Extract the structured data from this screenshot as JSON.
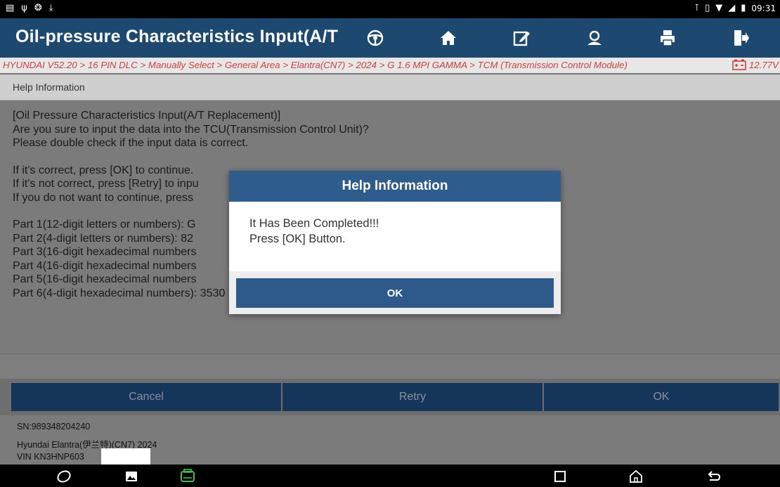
{
  "status_bar": {
    "left_icons": [
      "notification-icon",
      "usb-icon",
      "accessibility-icon",
      "download-icon"
    ],
    "right_icons": [
      "bluetooth-icon",
      "vibrate-icon",
      "wifi-icon",
      "signal-icon",
      "battery-icon"
    ],
    "time": "09:31"
  },
  "title_bar": {
    "title": "Oil-pressure Characteristics Input(A/T",
    "buttons": [
      "steering-wheel-icon",
      "home-icon",
      "edit-report-icon",
      "user-profile-icon",
      "printer-icon",
      "exit-icon"
    ]
  },
  "breadcrumb": {
    "path": "HYUNDAI V52.20 > 16 PIN DLC > Manually Select > General Area > Elantra(CN7) > 2024 > G 1.6 MPI GAMMA > TCM (Transmission Control Module)",
    "voltage": "12.77V"
  },
  "help_header": {
    "label": "Help Information"
  },
  "content": {
    "line1": "[Oil Pressure Characteristics Input(A/T Replacement)]",
    "line2": "Are you sure to input the data into the TCU(Transmission Control Unit)?",
    "line3": "Please double check if the input data is correct.",
    "line4": "If it's correct, press [OK] to continue.",
    "line5": "If it's not correct, press [Retry] to inpu",
    "line6": "If you do not want to continue, press",
    "part1": "Part 1(12-digit letters or numbers): G",
    "part2": "Part 2(4-digit letters or numbers): 82",
    "part3": "Part 3(16-digit hexadecimal numbers",
    "part4": "Part 4(16-digit hexadecimal numbers",
    "part5": "Part 5(16-digit hexadecimal numbers",
    "part6": "Part 6(4-digit hexadecimal numbers): 3530"
  },
  "actions": {
    "cancel": "Cancel",
    "retry": "Retry",
    "ok": "OK"
  },
  "footer": {
    "sn": "SN:989348204240",
    "vehicle": "Hyundai Elantra(伊兰特)(CN7) 2024",
    "vin": "VIN KN3HNP603"
  },
  "dialog": {
    "title": "Help Information",
    "message_line1": "It Has Been Completed!!!",
    "message_line2": "Press [OK] Button.",
    "ok_label": "OK"
  },
  "colors": {
    "title_bar": "#1d4870",
    "breadcrumb_text": "#d2403a",
    "dialog_title": "#2e5c8c",
    "action_button": "#15365a"
  }
}
